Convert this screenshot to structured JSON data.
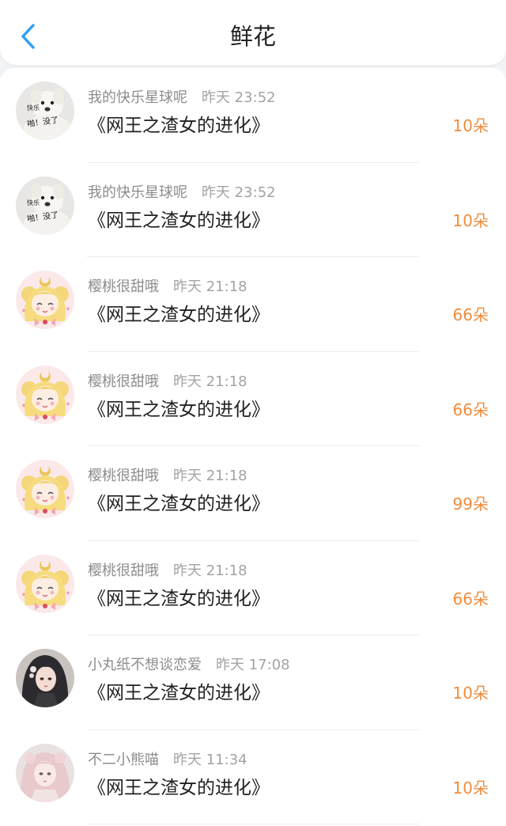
{
  "header": {
    "title": "鲜花",
    "back_icon": "chevron-left-icon",
    "accent_color": "#2e9ef3"
  },
  "colors": {
    "amount": "#f08c3c",
    "username": "#8c8c8c",
    "title": "#222222"
  },
  "records": [
    {
      "user": "我的快乐星球呢",
      "time": "昨天 23:52",
      "book": "《网王之渣女的进化》",
      "amount": "10朵",
      "avatar": "dog-meme",
      "avatar_caption_1": "快乐",
      "avatar_caption_2": "啪！没了"
    },
    {
      "user": "我的快乐星球呢",
      "time": "昨天 23:52",
      "book": "《网王之渣女的进化》",
      "amount": "10朵",
      "avatar": "dog-meme",
      "avatar_caption_1": "快乐",
      "avatar_caption_2": "啪！没了"
    },
    {
      "user": "樱桃很甜哦",
      "time": "昨天 21:18",
      "book": "《网王之渣女的进化》",
      "amount": "66朵",
      "avatar": "anime-girl-blonde"
    },
    {
      "user": "樱桃很甜哦",
      "time": "昨天 21:18",
      "book": "《网王之渣女的进化》",
      "amount": "66朵",
      "avatar": "anime-girl-blonde"
    },
    {
      "user": "樱桃很甜哦",
      "time": "昨天 21:18",
      "book": "《网王之渣女的进化》",
      "amount": "99朵",
      "avatar": "anime-girl-blonde"
    },
    {
      "user": "樱桃很甜哦",
      "time": "昨天 21:18",
      "book": "《网王之渣女的进化》",
      "amount": "66朵",
      "avatar": "anime-girl-blonde"
    },
    {
      "user": "小丸纸不想谈恋爱",
      "time": "昨天 17:08",
      "book": "《网王之渣女的进化》",
      "amount": "10朵",
      "avatar": "dark-hair-girl"
    },
    {
      "user": "不二小熊喵",
      "time": "昨天 11:34",
      "book": "《网王之渣女的进化》",
      "amount": "10朵",
      "avatar": "pink-hair-girl"
    }
  ]
}
